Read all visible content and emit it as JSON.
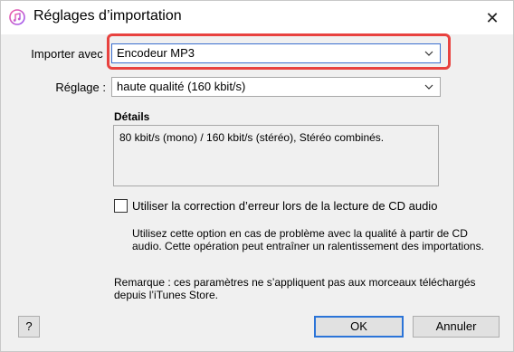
{
  "window": {
    "title": "Réglages d’importation",
    "close_glyph": "✕",
    "app_icon": "itunes-icon"
  },
  "import": {
    "label": "Importer avec :",
    "value": "Encodeur MP3"
  },
  "setting": {
    "label": "Réglage :",
    "value": "haute qualité (160 kbit/s)"
  },
  "details": {
    "title": "Détails",
    "text": "80 kbit/s (mono) / 160 kbit/s (stéréo), Stéréo combinés."
  },
  "error_correction": {
    "label": "Utiliser la correction d’erreur lors de la lecture de CD audio",
    "checked": false,
    "help": "Utilisez cette option en cas de problème avec la qualité à partir de CD audio. Cette opération peut entraîner un ralentissement des importations."
  },
  "note": "Remarque : ces paramètres ne s’appliquent pas aux morceaux téléchargés depuis l’iTunes Store.",
  "buttons": {
    "help": "?",
    "ok": "OK",
    "cancel": "Annuler"
  },
  "colors": {
    "highlight": "#e8423f",
    "focus": "#2b74d8"
  }
}
